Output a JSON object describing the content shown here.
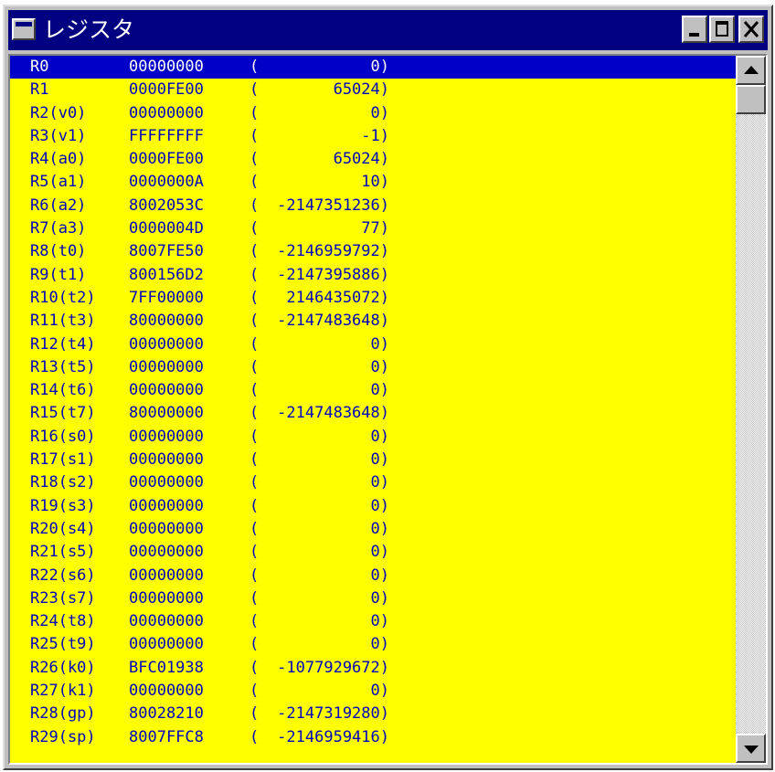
{
  "window": {
    "title": "レジスタ",
    "buttons": {
      "minimize": "minimize",
      "maximize": "maximize",
      "close": "close"
    }
  },
  "colors": {
    "list_background": "#ffff00",
    "list_text": "#0000c0",
    "selection_background": "#0000c8",
    "selection_text": "#ffffff",
    "titlebar": "#000080"
  },
  "icons": {
    "system": "window-system-icon",
    "minimize": "minimize-icon",
    "maximize": "maximize-icon",
    "close": "close-icon",
    "scroll_up": "arrow-up-icon",
    "scroll_down": "arrow-down-icon"
  },
  "selected_index": 0,
  "registers": [
    {
      "name": "R0",
      "hex": "00000000",
      "paren": "(",
      "dec": "0)"
    },
    {
      "name": "R1",
      "hex": "0000FE00",
      "paren": "(",
      "dec": "65024)"
    },
    {
      "name": "R2(v0)",
      "hex": "00000000",
      "paren": "(",
      "dec": "0)"
    },
    {
      "name": "R3(v1)",
      "hex": "FFFFFFFF",
      "paren": "(",
      "dec": "-1)"
    },
    {
      "name": "R4(a0)",
      "hex": "0000FE00",
      "paren": "(",
      "dec": "65024)"
    },
    {
      "name": "R5(a1)",
      "hex": "0000000A",
      "paren": "(",
      "dec": "10)"
    },
    {
      "name": "R6(a2)",
      "hex": "8002053C",
      "paren": "(",
      "dec": "-2147351236)"
    },
    {
      "name": "R7(a3)",
      "hex": "0000004D",
      "paren": "(",
      "dec": "77)"
    },
    {
      "name": "R8(t0)",
      "hex": "8007FE50",
      "paren": "(",
      "dec": "-2146959792)"
    },
    {
      "name": "R9(t1)",
      "hex": "800156D2",
      "paren": "(",
      "dec": "-2147395886)"
    },
    {
      "name": "R10(t2)",
      "hex": "7FF00000",
      "paren": "(",
      "dec": "2146435072)"
    },
    {
      "name": "R11(t3)",
      "hex": "80000000",
      "paren": "(",
      "dec": "-2147483648)"
    },
    {
      "name": "R12(t4)",
      "hex": "00000000",
      "paren": "(",
      "dec": "0)"
    },
    {
      "name": "R13(t5)",
      "hex": "00000000",
      "paren": "(",
      "dec": "0)"
    },
    {
      "name": "R14(t6)",
      "hex": "00000000",
      "paren": "(",
      "dec": "0)"
    },
    {
      "name": "R15(t7)",
      "hex": "80000000",
      "paren": "(",
      "dec": "-2147483648)"
    },
    {
      "name": "R16(s0)",
      "hex": "00000000",
      "paren": "(",
      "dec": "0)"
    },
    {
      "name": "R17(s1)",
      "hex": "00000000",
      "paren": "(",
      "dec": "0)"
    },
    {
      "name": "R18(s2)",
      "hex": "00000000",
      "paren": "(",
      "dec": "0)"
    },
    {
      "name": "R19(s3)",
      "hex": "00000000",
      "paren": "(",
      "dec": "0)"
    },
    {
      "name": "R20(s4)",
      "hex": "00000000",
      "paren": "(",
      "dec": "0)"
    },
    {
      "name": "R21(s5)",
      "hex": "00000000",
      "paren": "(",
      "dec": "0)"
    },
    {
      "name": "R22(s6)",
      "hex": "00000000",
      "paren": "(",
      "dec": "0)"
    },
    {
      "name": "R23(s7)",
      "hex": "00000000",
      "paren": "(",
      "dec": "0)"
    },
    {
      "name": "R24(t8)",
      "hex": "00000000",
      "paren": "(",
      "dec": "0)"
    },
    {
      "name": "R25(t9)",
      "hex": "00000000",
      "paren": "(",
      "dec": "0)"
    },
    {
      "name": "R26(k0)",
      "hex": "BFC01938",
      "paren": "(",
      "dec": "-1077929672)"
    },
    {
      "name": "R27(k1)",
      "hex": "00000000",
      "paren": "(",
      "dec": "0)"
    },
    {
      "name": "R28(gp)",
      "hex": "80028210",
      "paren": "(",
      "dec": "-2147319280)"
    },
    {
      "name": "R29(sp)",
      "hex": "8007FFC8",
      "paren": "(",
      "dec": "-2146959416)"
    }
  ]
}
